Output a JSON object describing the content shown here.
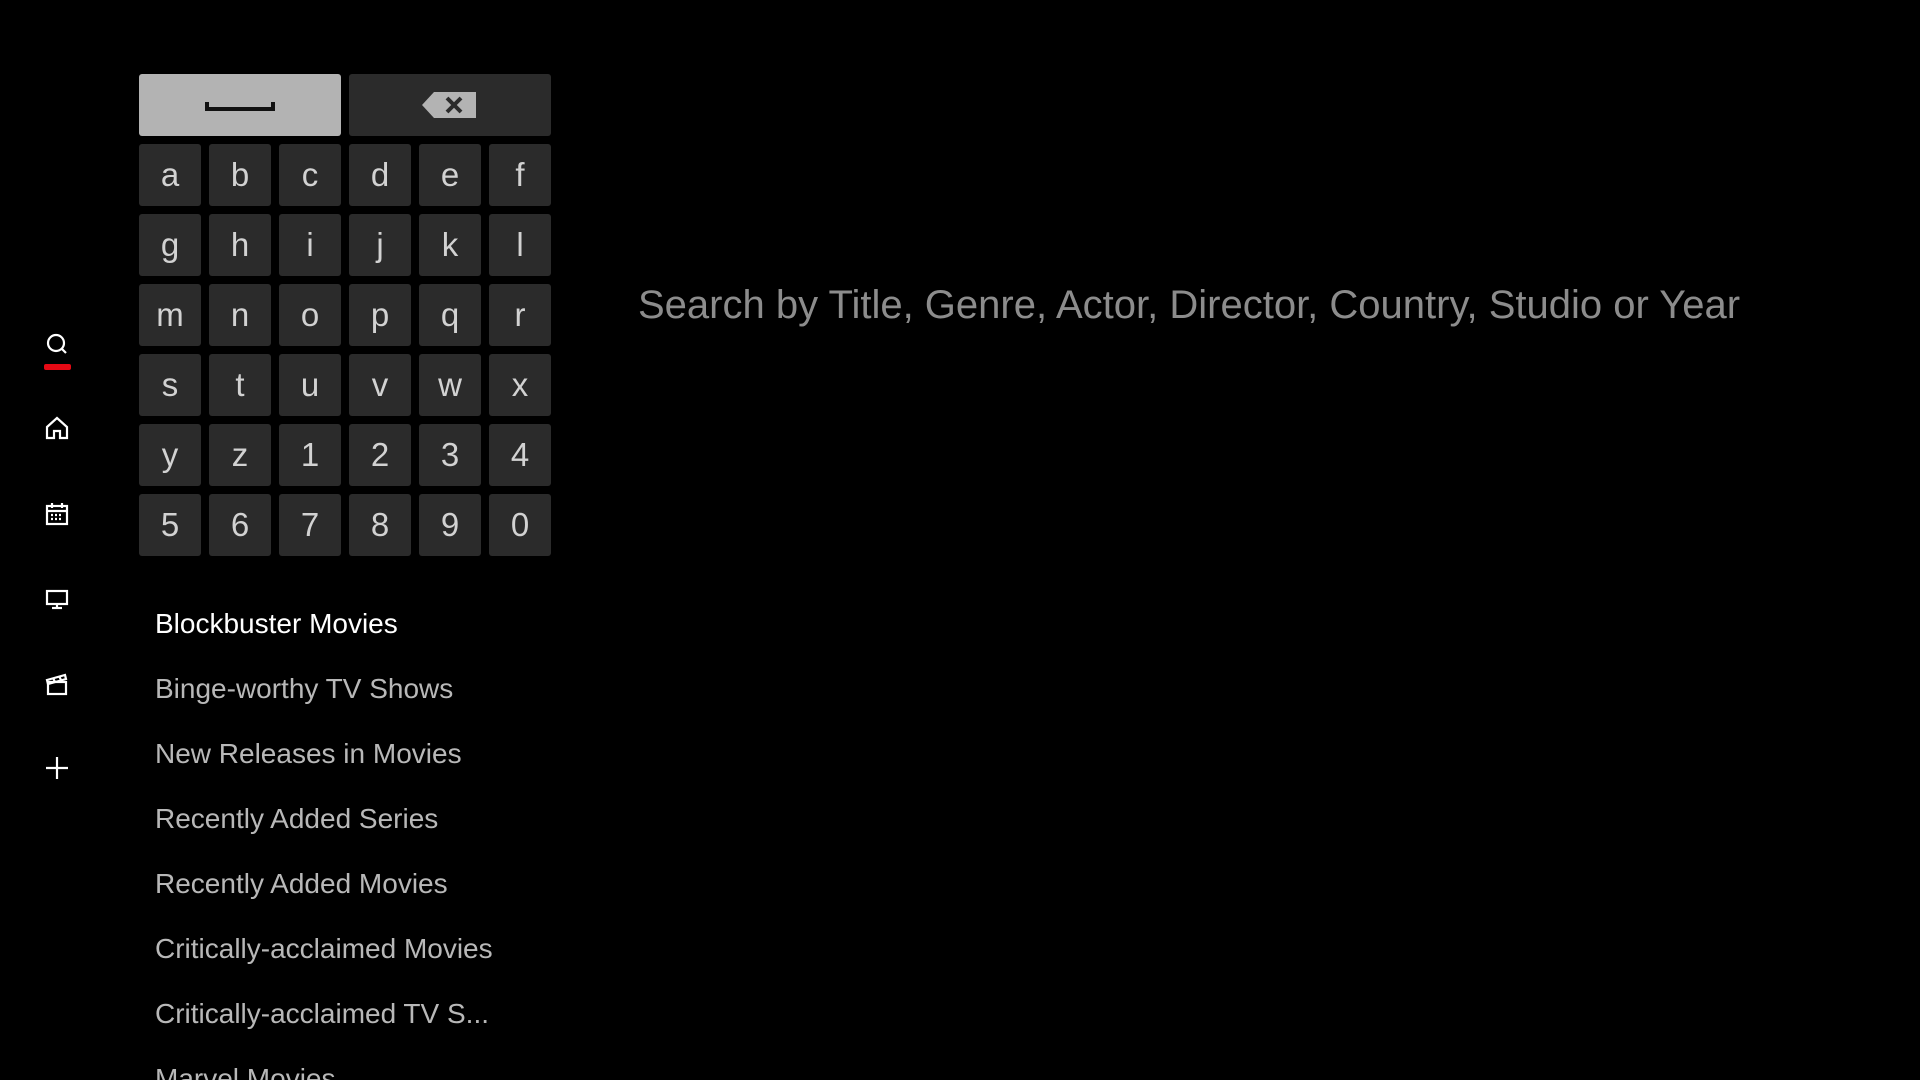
{
  "nav": {
    "items": [
      {
        "icon": "search-icon",
        "active": true
      },
      {
        "icon": "home-icon",
        "active": false
      },
      {
        "icon": "calendar-icon",
        "active": false
      },
      {
        "icon": "tv-icon",
        "active": false
      },
      {
        "icon": "movies-icon",
        "active": false
      },
      {
        "icon": "plus-icon",
        "active": false
      }
    ],
    "active_color": "#e50914"
  },
  "keyboard": {
    "space_icon": "space-icon",
    "backspace_icon": "backspace-icon",
    "keys": [
      "a",
      "b",
      "c",
      "d",
      "e",
      "f",
      "g",
      "h",
      "i",
      "j",
      "k",
      "l",
      "m",
      "n",
      "o",
      "p",
      "q",
      "r",
      "s",
      "t",
      "u",
      "v",
      "w",
      "x",
      "y",
      "z",
      "1",
      "2",
      "3",
      "4",
      "5",
      "6",
      "7",
      "8",
      "9",
      "0"
    ]
  },
  "suggestions": [
    "Blockbuster Movies",
    "Binge-worthy TV Shows",
    "New Releases in Movies",
    "Recently Added Series",
    "Recently Added Movies",
    "Critically-acclaimed Movies",
    "Critically-acclaimed TV S...",
    "Marvel Movies"
  ],
  "search": {
    "hint": "Search by Title, Genre, Actor, Director, Country, Studio or Year"
  }
}
